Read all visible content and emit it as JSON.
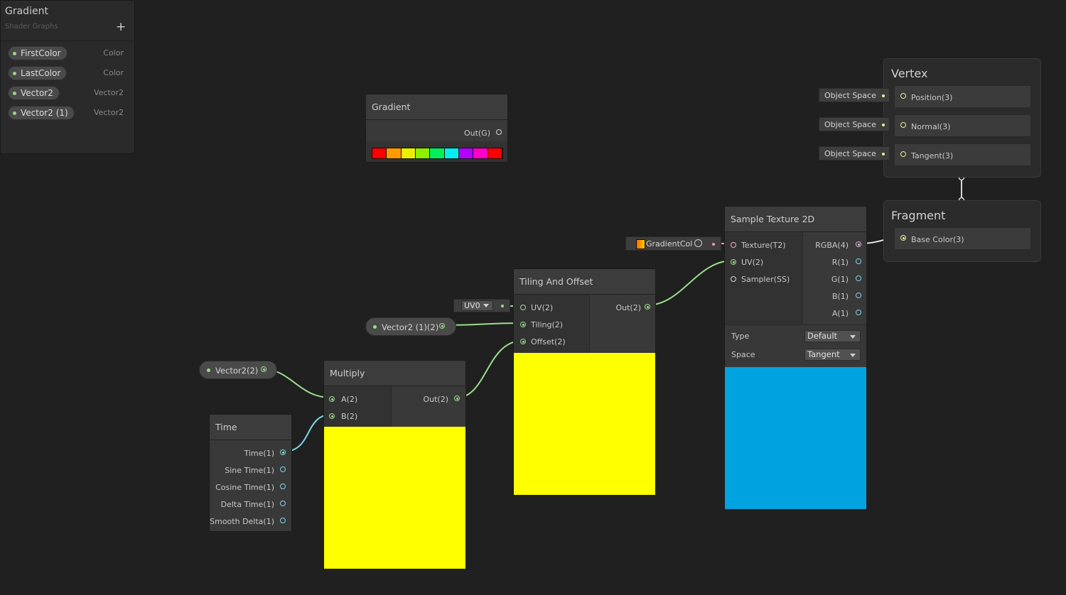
{
  "blackboard": {
    "title": "Gradient",
    "subtitle": "Shader Graphs",
    "add_label": "+",
    "properties": [
      {
        "name": "FirstColor",
        "type": "Color"
      },
      {
        "name": "LastColor",
        "type": "Color"
      },
      {
        "name": "Vector2",
        "type": "Vector2"
      },
      {
        "name": "Vector2 (1)",
        "type": "Vector2"
      }
    ]
  },
  "gradient_node": {
    "title": "Gradient",
    "output": "Out(G)",
    "swatches": [
      "#ff0000",
      "#ff9a00",
      "#eaf000",
      "#8cf000",
      "#00f05a",
      "#00f0ef",
      "#b400ff",
      "#ff00c8",
      "#ff0000"
    ]
  },
  "vector2_1_pill": {
    "label": "Vector2 (1)(2)"
  },
  "vector2_pill": {
    "label": "Vector2(2)"
  },
  "uv_dropdown": {
    "value": "UV0"
  },
  "tiling_node": {
    "title": "Tiling And Offset",
    "inputs": [
      "UV(2)",
      "Tiling(2)",
      "Offset(2)"
    ],
    "output": "Out(2)",
    "preview_color": "#ffff00"
  },
  "multiply_node": {
    "title": "Multiply",
    "inputs": [
      "A(2)",
      "B(2)"
    ],
    "output": "Out(2)",
    "preview_color": "#ffff00"
  },
  "time_node": {
    "title": "Time",
    "outputs": [
      "Time(1)",
      "Sine Time(1)",
      "Cosine Time(1)",
      "Delta Time(1)",
      "Smooth Delta(1)"
    ]
  },
  "texture_chip": {
    "label": "GradientColc"
  },
  "sample_node": {
    "title": "Sample Texture 2D",
    "inputs": [
      "Texture(T2)",
      "UV(2)",
      "Sampler(SS)"
    ],
    "outputs": [
      "RGBA(4)",
      "R(1)",
      "G(1)",
      "B(1)",
      "A(1)"
    ],
    "type_label": "Type",
    "type_value": "Default",
    "space_label": "Space",
    "space_value": "Tangent",
    "preview_color": "#00a3e0"
  },
  "vertex": {
    "title": "Vertex",
    "slots": [
      "Position(3)",
      "Normal(3)",
      "Tangent(3)"
    ],
    "space_chips": [
      "Object Space",
      "Object Space",
      "Object Space"
    ]
  },
  "fragment": {
    "title": "Fragment",
    "slots": [
      "Base Color(3)"
    ]
  },
  "colors": {
    "wire_vector": "#9bdd8d",
    "wire_float": "#7fd6e6",
    "wire_texture": "#ff9aa9",
    "wire_vector3": "#f2ec9a",
    "wire_vector4": "#e8e8e8"
  }
}
